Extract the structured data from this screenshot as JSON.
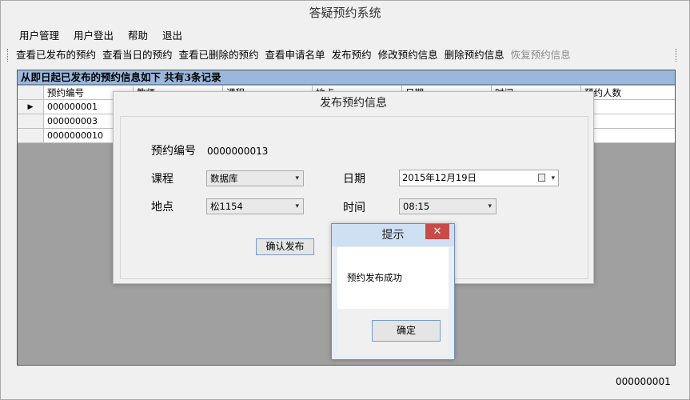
{
  "window": {
    "title": "答疑预约系统"
  },
  "menu": [
    "用户管理",
    "用户登出",
    "帮助",
    "退出"
  ],
  "toolbar": [
    {
      "label": "查看已发布的预约",
      "enabled": true
    },
    {
      "label": "查看当日的预约",
      "enabled": true
    },
    {
      "label": "查看已删除的预约",
      "enabled": true
    },
    {
      "label": "查看申请名单",
      "enabled": true
    },
    {
      "label": "发布预约",
      "enabled": true
    },
    {
      "label": "修改预约信息",
      "enabled": true
    },
    {
      "label": "删除预约信息",
      "enabled": true
    },
    {
      "label": "恢复预约信息",
      "enabled": false
    }
  ],
  "panel": {
    "header": "从即日起已发布的预约信息如下 共有3条记录",
    "columns": [
      "预约编号",
      "教师",
      "课程",
      "地点",
      "日期",
      "时间",
      "预约人数"
    ],
    "rows": [
      {
        "id": "000000001",
        "current": true
      },
      {
        "id": "000000003",
        "current": false
      },
      {
        "id": "0000000010",
        "current": false
      }
    ],
    "current_row_marker": "▶"
  },
  "publish_dialog": {
    "title": "发布预约信息",
    "id_label": "预约编号",
    "id_value": "0000000013",
    "course_label": "课程",
    "course_value": "数据库",
    "date_label": "日期",
    "date_value": "2015年12月19日",
    "location_label": "地点",
    "location_value": "松1154",
    "time_label": "时间",
    "time_value": "08:15",
    "confirm_label": "确认发布"
  },
  "message_box": {
    "title": "提示",
    "message": "预约发布成功",
    "ok_label": "确定",
    "close_glyph": "✕"
  },
  "status": {
    "user_id": "000000001"
  },
  "icons": {
    "dropdown": "▾",
    "calendar": "calendar-icon"
  },
  "colors": {
    "panel_header": "#9ab8dc",
    "close_button": "#c74b47",
    "grid_background": "#a0a0a0"
  }
}
